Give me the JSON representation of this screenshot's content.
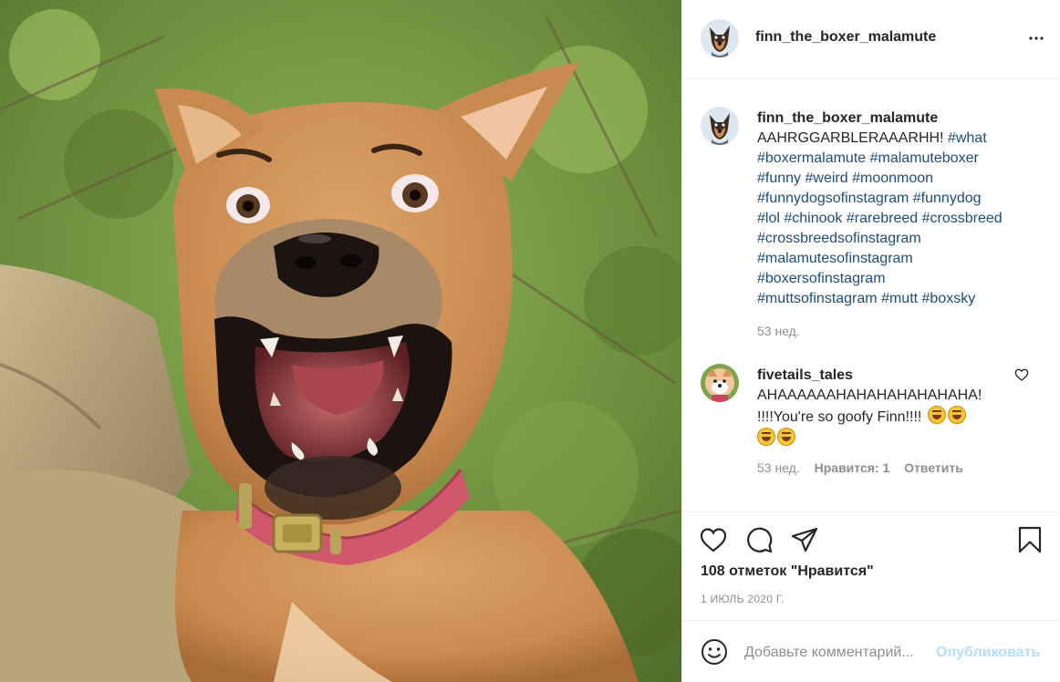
{
  "header": {
    "username": "finn_the_boxer_malamute",
    "more_icon": "more-options-icon"
  },
  "caption": {
    "username": "finn_the_boxer_malamute",
    "lines": [
      "AAHRGGARBLERAAARHH! #what",
      "#boxermalamute #malamuteboxer",
      "#funny #weird #moonmoon",
      "#funnydogsofinstagram #funnydog",
      "#lol #chinook #rarebreed #crossbreed",
      "#crossbreedsofinstagram",
      "#malamutesofinstagram",
      "#boxersofinstagram",
      "#muttsofinstagram #mutt #boxsky"
    ],
    "time": "53 нед."
  },
  "comment": {
    "username": "fivetails_tales",
    "text_line1": "AHAAAAAAHAHAHAHAHAHAHA!",
    "text_line2": "!!!!You're so goofy Finn!!!!",
    "time": "53 нед.",
    "likes": "Нравится: 1",
    "reply": "Ответить"
  },
  "actions": {
    "likes": "108 отметок \"Нравится\"",
    "date": "1 ИЮЛЬ 2020 Г."
  },
  "add_comment": {
    "placeholder": "Добавьте комментарий...",
    "publish": "Опубликовать"
  },
  "colors": {
    "hashtag": "#1f4d7a",
    "muted": "#8e8e8e",
    "publish_disabled": "#b2dffc",
    "border": "#efefef"
  }
}
